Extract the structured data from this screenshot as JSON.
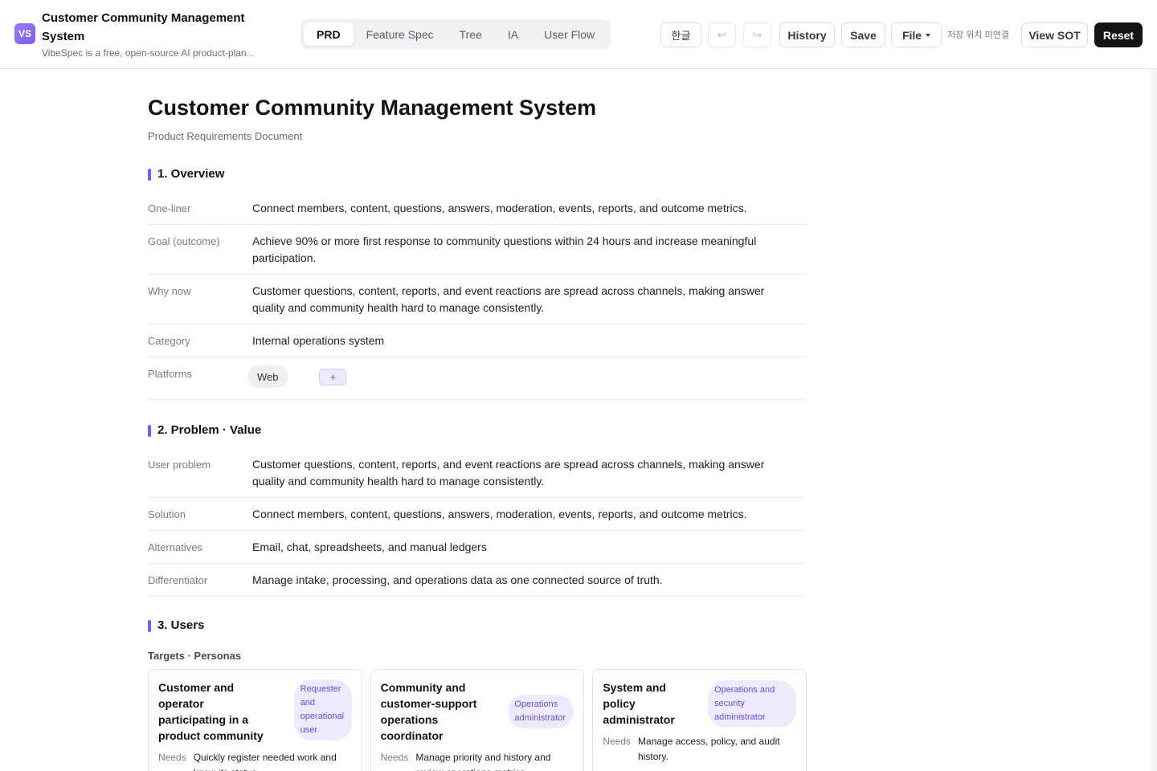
{
  "header": {
    "logo_text": "VS",
    "title": "Customer Community Management System",
    "subtitle": "VibeSpec is a free, open-source AI product-plan...",
    "tabs": [
      {
        "label": "PRD",
        "active": true
      },
      {
        "label": "Feature Spec",
        "active": false
      },
      {
        "label": "Tree",
        "active": false
      },
      {
        "label": "IA",
        "active": false
      },
      {
        "label": "User Flow",
        "active": false
      }
    ],
    "lang_label": "한글",
    "undo_icon": "↩",
    "redo_icon": "↪",
    "history_label": "History",
    "save_label": "Save",
    "file_label": "File",
    "storage_status": "저장 위치 미연결",
    "view_sot_label": "View SOT",
    "reset_label": "Reset"
  },
  "colors": {
    "accent": "#7b5cf0",
    "reset_bg": "#141418"
  },
  "doc": {
    "title": "Customer Community Management System",
    "subtitle": "Product Requirements Document",
    "sections": {
      "overview": {
        "heading": "1. Overview",
        "rows": [
          {
            "label": "One-liner",
            "value": "Connect members, content, questions, answers, moderation, events, reports, and outcome metrics."
          },
          {
            "label": "Goal (outcome)",
            "value": "Achieve 90% or more first response to community questions within 24 hours and increase meaningful participation."
          },
          {
            "label": "Why now",
            "value": "Customer questions, content, reports, and event reactions are spread across channels, making answer quality and community health hard to manage consistently."
          },
          {
            "label": "Category",
            "value": "Internal operations system"
          }
        ],
        "platforms_label": "Platforms",
        "platforms": [
          "Web"
        ],
        "add_platform": "+"
      },
      "problem": {
        "heading": "2. Problem · Value",
        "rows": [
          {
            "label": "User problem",
            "value": "Customer questions, content, reports, and event reactions are spread across channels, making answer quality and community health hard to manage consistently."
          },
          {
            "label": "Solution",
            "value": "Connect members, content, questions, answers, moderation, events, reports, and outcome metrics."
          },
          {
            "label": "Alternatives",
            "value": "Email, chat, spreadsheets, and manual ledgers"
          },
          {
            "label": "Differentiator",
            "value": "Manage intake, processing, and operations data as one connected source of truth."
          }
        ]
      },
      "users": {
        "heading": "3. Users",
        "personas_label": "Targets · Personas",
        "personas": [
          {
            "name": "Customer and operator participating in a product community",
            "role": "Requester and operational user",
            "needs_label": "Needs",
            "needs": "Quickly register needed work and know its status."
          },
          {
            "name": "Community and customer-support operations coordinator",
            "role": "Operations administrator",
            "needs_label": "Needs",
            "needs": "Manage priority and history and review operations metrics."
          },
          {
            "name": "System and policy administrator",
            "role": "Operations and security administrator",
            "needs_label": "Needs",
            "needs": "Manage access, policy, and audit history."
          }
        ]
      }
    }
  }
}
